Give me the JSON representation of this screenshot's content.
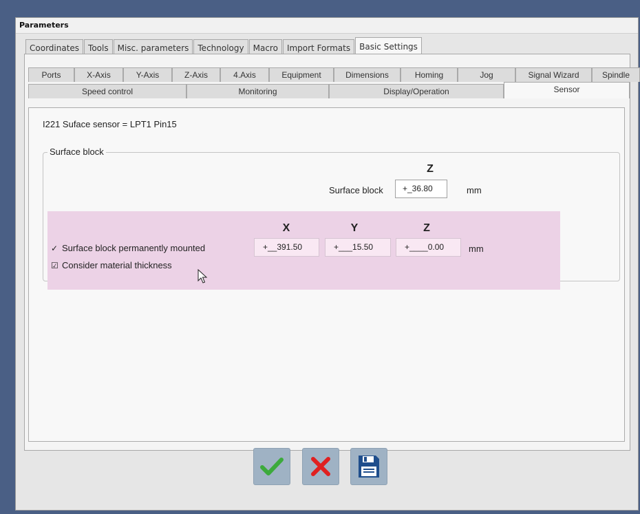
{
  "window": {
    "title": "Parameters"
  },
  "main_tabs": [
    {
      "label": "Coordinates",
      "active": false
    },
    {
      "label": "Tools",
      "active": false
    },
    {
      "label": "Misc. parameters",
      "active": false
    },
    {
      "label": "Technology",
      "active": false
    },
    {
      "label": "Macro",
      "active": false
    },
    {
      "label": "Import Formats",
      "active": false
    },
    {
      "label": "Basic Settings",
      "active": true
    }
  ],
  "sub_tabs_row1": [
    "Ports",
    "X-Axis",
    "Y-Axis",
    "Z-Axis",
    "4.Axis",
    "Equipment",
    "Dimensions",
    "Homing",
    "Jog",
    "Signal Wizard",
    "Spindle"
  ],
  "sub_tabs_row2": [
    {
      "label": "Speed control",
      "active": false
    },
    {
      "label": "Monitoring",
      "active": false
    },
    {
      "label": "Display/Operation",
      "active": false
    },
    {
      "label": "Sensor",
      "active": true
    }
  ],
  "sensor": {
    "info": "I221 Suface sensor = LPT1 Pin15",
    "group_title": "Surface block",
    "z_header": "Z",
    "surface_block_label": "Surface block",
    "surface_block_value": "+_36.80",
    "unit": "mm",
    "headers": {
      "x": "X",
      "y": "Y",
      "z": "Z"
    },
    "permanent_label": "Surface block permanently mounted",
    "permanent_checked": true,
    "material_label": "Consider material thickness",
    "material_checked": true,
    "pos_x": "+__391.50",
    "pos_y": "+___15.50",
    "pos_z": "+____0.00",
    "pos_unit": "mm"
  },
  "colors": {
    "highlight": "#ecd2e6",
    "ok_icon": "#3caa3c",
    "cancel_icon": "#e02020",
    "save_icon": "#1f4e8c"
  },
  "icons": {
    "ok": "checkmark-icon",
    "cancel": "x-icon",
    "save": "floppy-disk-icon"
  }
}
